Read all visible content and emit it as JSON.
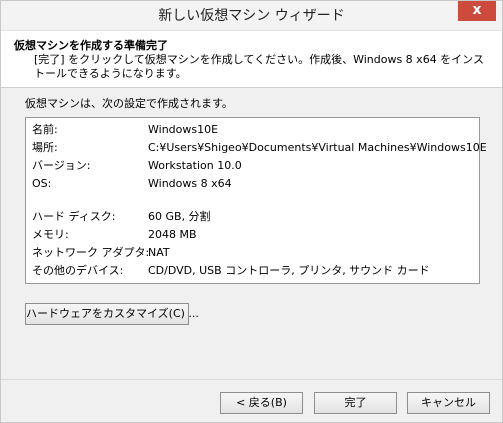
{
  "window": {
    "title": "新しい仮想マシン ウィザード",
    "close_glyph": "x"
  },
  "header": {
    "title": "仮想マシンを作成する準備完了",
    "description": "[完了] をクリックして仮想マシンを作成してください。作成後、Windows 8 x64 をインストールできるようになります。"
  },
  "body": {
    "intro": "仮想マシンは、次の設定で作成されます。",
    "summary": [
      {
        "label": "名前:",
        "value": "Windows10E"
      },
      {
        "label": "場所:",
        "value": "C:¥Users¥Shigeo¥Documents¥Virtual Machines¥Windows10E"
      },
      {
        "label": "バージョン:",
        "value": "Workstation 10.0"
      },
      {
        "label": "OS:",
        "value": "Windows 8 x64"
      },
      {
        "label": "ハード ディスク:",
        "value": "60 GB, 分割"
      },
      {
        "label": "メモリ:",
        "value": "2048 MB"
      },
      {
        "label": "ネットワーク アダプタ:",
        "value": "NAT"
      },
      {
        "label": "その他のデバイス:",
        "value": "CD/DVD, USB コントローラ, プリンタ, サウンド カード"
      }
    ],
    "customize_button": "ハードウェアをカスタマイズ(C) ..."
  },
  "footer": {
    "back_button": "< 戻る(B)",
    "finish_button": "完了",
    "cancel_button": "キャンセル"
  }
}
